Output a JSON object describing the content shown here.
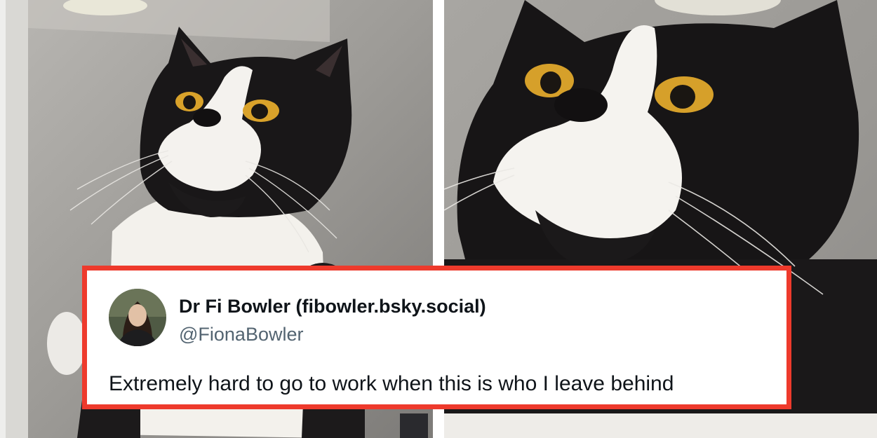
{
  "tweet": {
    "display_name": "Dr Fi Bowler (fibowler.bsky.social)",
    "handle": "@FionaBowler",
    "text": "Extremely hard to go to work when this is who I leave behind"
  },
  "colors": {
    "card_border": "#ee3a2c",
    "name_text": "#0f1419",
    "handle_text": "#536471",
    "background_wall": "#9a9793"
  },
  "images": {
    "left_photo": "tuxedo-cat-looking-up",
    "right_photo": "tuxedo-cat-closeup-looking-up",
    "avatar": "profile-photo-woman"
  }
}
